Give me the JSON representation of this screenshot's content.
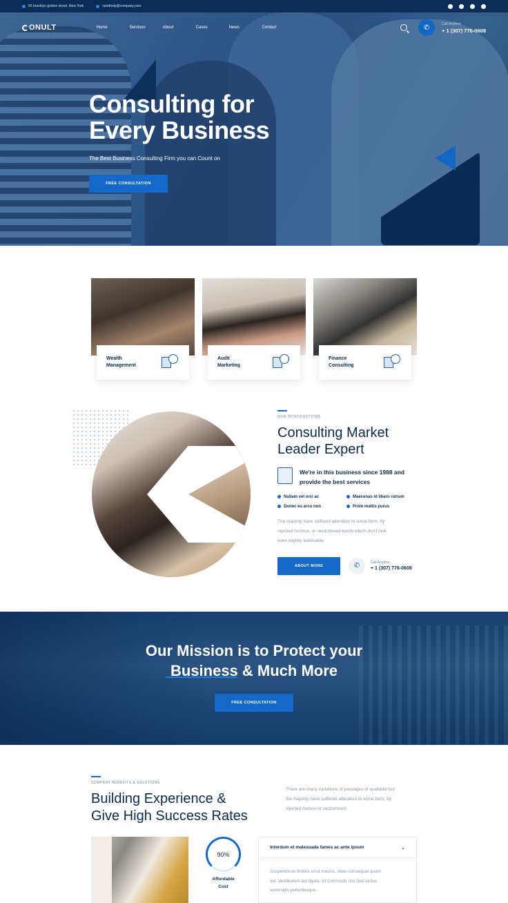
{
  "topbar": {
    "address": "55 brooklyn golden street. New York",
    "email": "needhelp@company.com",
    "social_icons": [
      "twitter-icon",
      "facebook-icon",
      "pinterest-icon",
      "instagram-icon"
    ]
  },
  "nav": {
    "logo": "ONULT",
    "menu": [
      "Home",
      "Services",
      "About",
      "Cases",
      "News",
      "Contact"
    ],
    "call_label": "Call Anytime",
    "phone": "+ 1 (307) 776-0608"
  },
  "hero": {
    "title_line1": "Consulting for",
    "title_line2": "Every Business",
    "subtitle": "The Best Business Consulting Firm you can Count on",
    "button": "FREE CONSULTATION"
  },
  "services": [
    {
      "line1": "Wealth",
      "line2": "Management",
      "icon": "wealth-icon"
    },
    {
      "line1": "Audit",
      "line2": "Marketing",
      "icon": "audit-icon"
    },
    {
      "line1": "Finance",
      "line2": "Consulting",
      "icon": "finance-icon"
    }
  ],
  "intro": {
    "eyebrow": "OUR INTRODUCTIONS",
    "title_line1": "Consulting Market",
    "title_line2": "Leader Expert",
    "since_line1": "We're in this business since 1988 and",
    "since_line2": "provide the best services",
    "checks": [
      "Nullam vel orci ac",
      "Maecenas id libero rutrum",
      "Donec eu arcu non",
      "Proin mattis purus"
    ],
    "body_line1": "The majority have suffered alteration in some form, by",
    "body_line2": "injected humour, or randomised words which don't look",
    "body_line3": "even slightly believable.",
    "button": "ABOUT MORE",
    "call_label": "Call Anytime",
    "phone": "+ 1 (307) 776-0608"
  },
  "mission": {
    "line1": "Our Mission is to Protect your",
    "line2": "Business & Much More",
    "button": "FREE CONSULTATION"
  },
  "benefits": {
    "eyebrow": "COMPANY BENEFITS & SOLUTIONS",
    "title_line1": "Building Experience &",
    "title_line2": "Give High Success Rates",
    "text_line1": "There are many variations of passages of available but",
    "text_line2": "the majority have suffered alteration in some form, by",
    "text_line3": "injected humou or randomised.",
    "progress_value": "90%",
    "progress_fraction": 0.9,
    "progress_label_line1": "Affordable",
    "progress_label_line2": "Cost",
    "accordion_title": "Interdum et malesuada fames ac ante ipsum",
    "accordion_line1": "Suspendisse finibus urna mauris, vitae consequat quam",
    "accordion_line2": "vel. Vestibulum leo ligula, vit commodo nisl Sed luctus",
    "accordion_line3": "venenatis pellentesque."
  },
  "colors": {
    "primary": "#1468c8",
    "navy": "#0a2c57",
    "text_dark": "#0b2a4a",
    "text_muted": "#8996a6"
  }
}
